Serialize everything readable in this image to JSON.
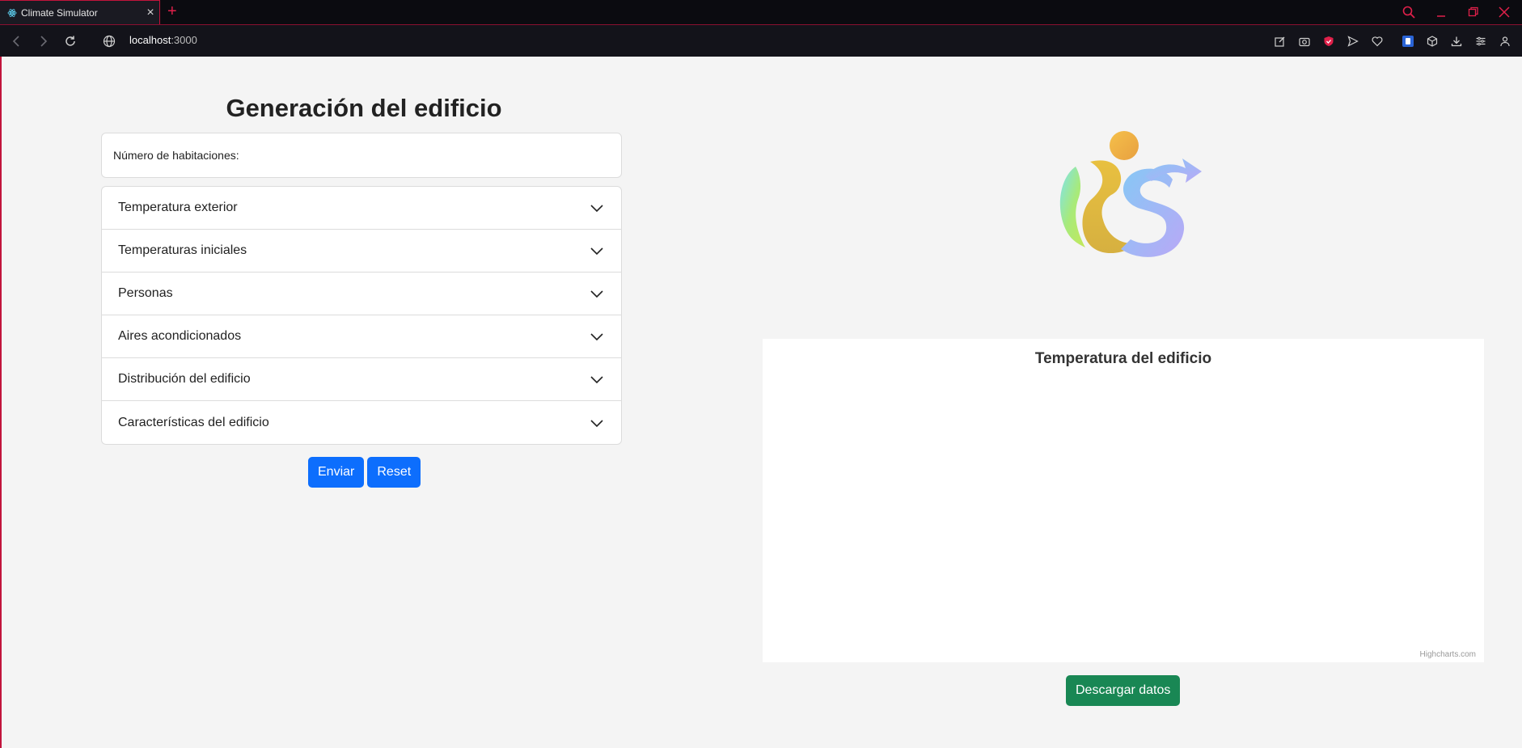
{
  "browser": {
    "tab_title": "Climate Simulator",
    "new_tab": "+",
    "url_host": "localhost",
    "url_port": ":3000"
  },
  "form": {
    "heading": "Generación del edificio",
    "rooms_label": "Número de habitaciones:",
    "sections": [
      "Temperatura exterior",
      "Temperaturas iniciales",
      "Personas",
      "Aires acondicionados",
      "Distribución del edificio",
      "Características del edificio"
    ],
    "submit_label": "Enviar",
    "reset_label": "Reset"
  },
  "chart": {
    "title": "Temperatura del edificio",
    "credits": "Highcharts.com"
  },
  "actions": {
    "download_label": "Descargar datos"
  },
  "colors": {
    "primary": "#0d6efd",
    "success": "#198754",
    "accent": "#c2143c"
  }
}
